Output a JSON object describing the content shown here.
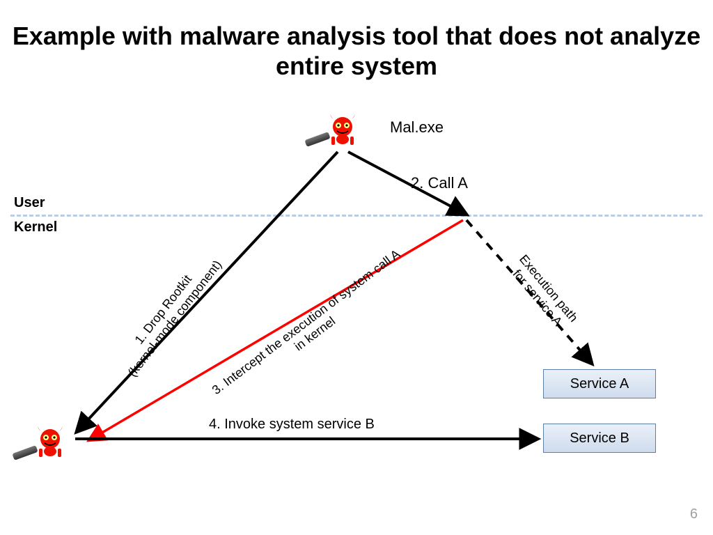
{
  "title": "Example with malware analysis tool that does not analyze entire system",
  "labels": {
    "user": "User",
    "kernel": "Kernel",
    "mal_exe": "Mal.exe",
    "call_a": "2. Call A",
    "drop_rootkit": "1. Drop Rootkit\n(kernel-mode component)",
    "intercept": "3. Intercept the execution of system call A\nin kernel",
    "exec_path": "Execution path\nfor service A",
    "invoke_b": "4. Invoke system service B"
  },
  "services": {
    "a": "Service A",
    "b": "Service B"
  },
  "icons": {
    "devil_top": "devil-icon",
    "devil_bottom": "devil-icon"
  },
  "page_number": "6"
}
